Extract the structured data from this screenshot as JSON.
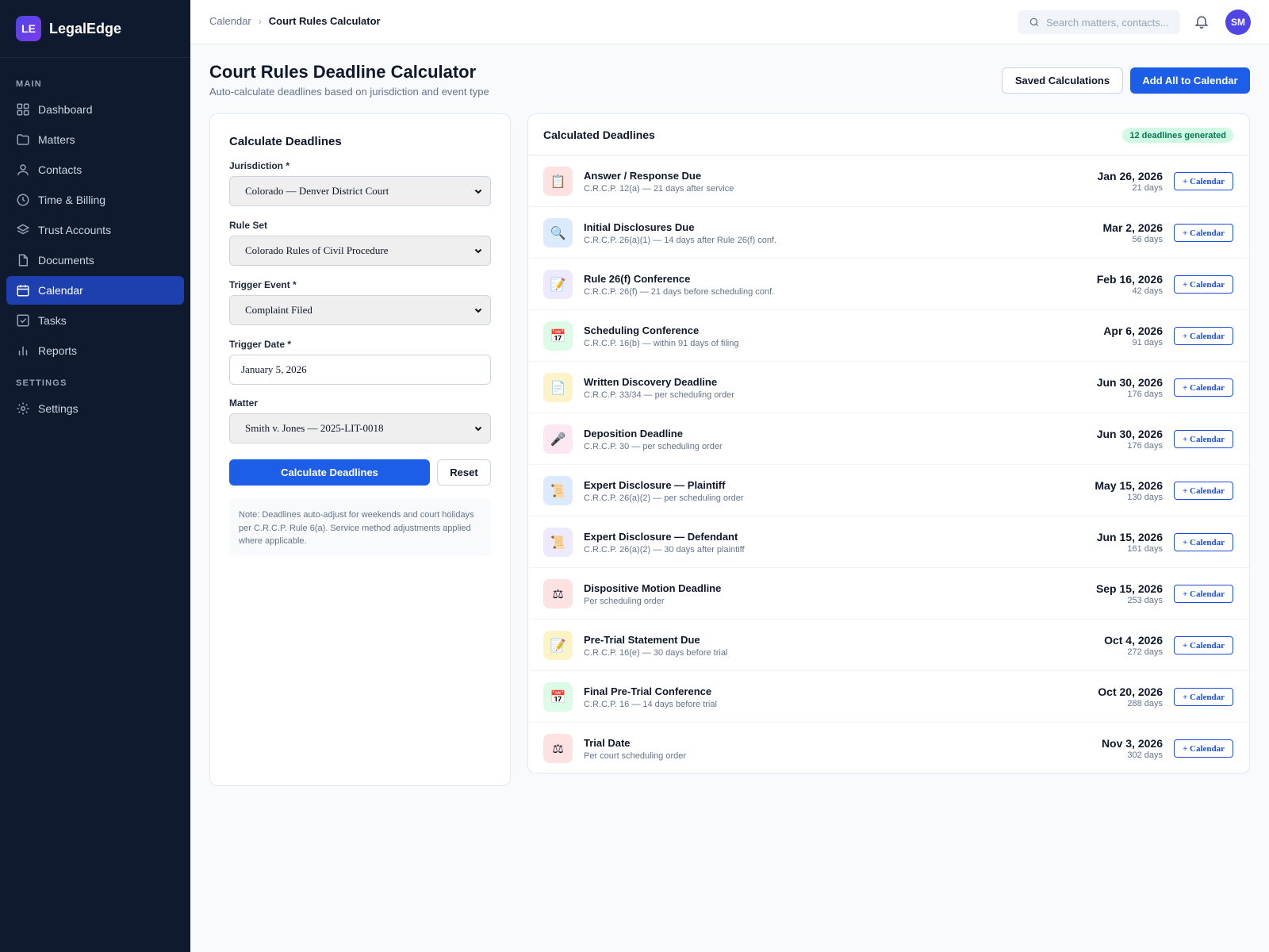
{
  "brand": {
    "logo": "LE",
    "name": "LegalEdge"
  },
  "sidebar": {
    "main_label": "MAIN",
    "settings_label": "SETTINGS",
    "items": [
      {
        "label": "Dashboard",
        "icon": "grid-icon"
      },
      {
        "label": "Matters",
        "icon": "folder-icon"
      },
      {
        "label": "Contacts",
        "icon": "user-icon"
      },
      {
        "label": "Time & Billing",
        "icon": "clock-icon"
      },
      {
        "label": "Trust Accounts",
        "icon": "layers-icon"
      },
      {
        "label": "Documents",
        "icon": "document-icon"
      },
      {
        "label": "Calendar",
        "icon": "calendar-icon",
        "active": true
      },
      {
        "label": "Tasks",
        "icon": "checkbox-icon"
      },
      {
        "label": "Reports",
        "icon": "bar-chart-icon"
      }
    ],
    "settings_items": [
      {
        "label": "Settings",
        "icon": "gear-icon"
      }
    ]
  },
  "topbar": {
    "breadcrumb": [
      "Calendar",
      "Court Rules Calculator"
    ],
    "search_placeholder": "Search matters, contacts...",
    "avatar_initials": "SM"
  },
  "page": {
    "title": "Court Rules Deadline Calculator",
    "subtitle": "Auto-calculate deadlines based on jurisdiction and event type",
    "saved_button": "Saved Calculations",
    "add_all_button": "Add All to Calendar"
  },
  "form": {
    "title": "Calculate Deadlines",
    "jurisdiction_label": "Jurisdiction *",
    "jurisdiction_value": "Colorado — Denver District Court",
    "ruleset_label": "Rule Set",
    "ruleset_value": "Colorado Rules of Civil Procedure",
    "trigger_event_label": "Trigger Event *",
    "trigger_event_value": "Complaint Filed",
    "trigger_date_label": "Trigger Date *",
    "trigger_date_value": "January 5, 2026",
    "matter_label": "Matter",
    "matter_value": "Smith v. Jones — 2025-LIT-0018",
    "calculate_button": "Calculate Deadlines",
    "reset_button": "Reset",
    "note": "Note: Deadlines auto-adjust for weekends and court holidays per C.R.C.P. Rule 6(a). Service method adjustments applied where applicable."
  },
  "deadlines": {
    "title": "Calculated Deadlines",
    "badge": "12 deadlines generated",
    "calendar_button": "+ Calendar",
    "items": [
      {
        "title": "Answer / Response Due",
        "rule": "C.R.C.P. 12(a) — 21 days after service",
        "date": "Jan 26, 2026",
        "days": "21 days",
        "glyph": "📋",
        "icon": "clipboard-icon",
        "bg": "#fee2e2"
      },
      {
        "title": "Initial Disclosures Due",
        "rule": "C.R.C.P. 26(a)(1) — 14 days after Rule 26(f) conf.",
        "date": "Mar 2, 2026",
        "days": "56 days",
        "glyph": "🔍",
        "icon": "magnifier-icon",
        "bg": "#dbeafe"
      },
      {
        "title": "Rule 26(f) Conference",
        "rule": "C.R.C.P. 26(f) — 21 days before scheduling conf.",
        "date": "Feb 16, 2026",
        "days": "42 days",
        "glyph": "📝",
        "icon": "memo-icon",
        "bg": "#ede9fe"
      },
      {
        "title": "Scheduling Conference",
        "rule": "C.R.C.P. 16(b) — within 91 days of filing",
        "date": "Apr 6, 2026",
        "days": "91 days",
        "glyph": "📅",
        "icon": "calendar-page-icon",
        "bg": "#dcfce7"
      },
      {
        "title": "Written Discovery Deadline",
        "rule": "C.R.C.P. 33/34 — per scheduling order",
        "date": "Jun 30, 2026",
        "days": "176 days",
        "glyph": "📄",
        "icon": "page-icon",
        "bg": "#fef3c7"
      },
      {
        "title": "Deposition Deadline",
        "rule": "C.R.C.P. 30 — per scheduling order",
        "date": "Jun 30, 2026",
        "days": "176 days",
        "glyph": "🎤",
        "icon": "microphone-icon",
        "bg": "#fce7f3"
      },
      {
        "title": "Expert Disclosure — Plaintiff",
        "rule": "C.R.C.P. 26(a)(2) — per scheduling order",
        "date": "May 15, 2026",
        "days": "130 days",
        "glyph": "📜",
        "icon": "scroll-icon",
        "bg": "#dbeafe"
      },
      {
        "title": "Expert Disclosure — Defendant",
        "rule": "C.R.C.P. 26(a)(2) — 30 days after plaintiff",
        "date": "Jun 15, 2026",
        "days": "161 days",
        "glyph": "📜",
        "icon": "scroll-icon",
        "bg": "#ede9fe"
      },
      {
        "title": "Dispositive Motion Deadline",
        "rule": "Per scheduling order",
        "date": "Sep 15, 2026",
        "days": "253 days",
        "glyph": "⚖",
        "icon": "scales-icon",
        "bg": "#fee2e2"
      },
      {
        "title": "Pre-Trial Statement Due",
        "rule": "C.R.C.P. 16(e) — 30 days before trial",
        "date": "Oct 4, 2026",
        "days": "272 days",
        "glyph": "📝",
        "icon": "memo-icon",
        "bg": "#fef3c7"
      },
      {
        "title": "Final Pre-Trial Conference",
        "rule": "C.R.C.P. 16 — 14 days before trial",
        "date": "Oct 20, 2026",
        "days": "288 days",
        "glyph": "📅",
        "icon": "calendar-page-icon",
        "bg": "#dcfce7"
      },
      {
        "title": "Trial Date",
        "rule": "Per court scheduling order",
        "date": "Nov 3, 2026",
        "days": "302 days",
        "glyph": "⚖",
        "icon": "scales-icon",
        "bg": "#fee2e2"
      }
    ]
  }
}
